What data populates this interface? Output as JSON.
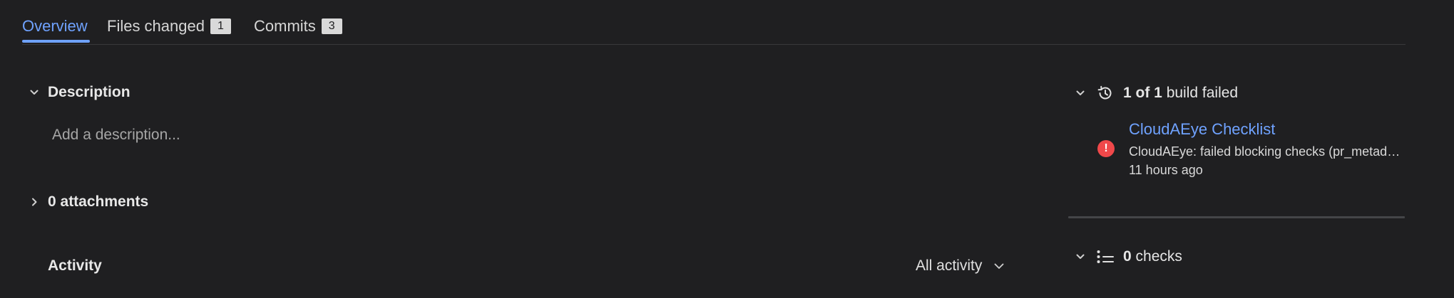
{
  "tabs": [
    {
      "label": "Overview",
      "count": null
    },
    {
      "label": "Files changed",
      "count": "1"
    },
    {
      "label": "Commits",
      "count": "3"
    }
  ],
  "description": {
    "title": "Description",
    "placeholder": "Add a description..."
  },
  "attachments": {
    "title": "0 attachments"
  },
  "activity": {
    "title": "Activity",
    "filter_label": "All activity"
  },
  "builds": {
    "summary_bold": "1 of 1",
    "summary_rest": " build failed",
    "items": [
      {
        "name": "CloudAEye Checklist",
        "description": "CloudAEye: failed blocking checks (pr_metadata)",
        "time": "11 hours ago",
        "status_icon": "error-icon"
      }
    ]
  },
  "checks": {
    "count": "0",
    "label": " checks"
  },
  "colors": {
    "background": "#1f1f21",
    "accent": "#6fa2ff",
    "error": "#f0484a"
  }
}
